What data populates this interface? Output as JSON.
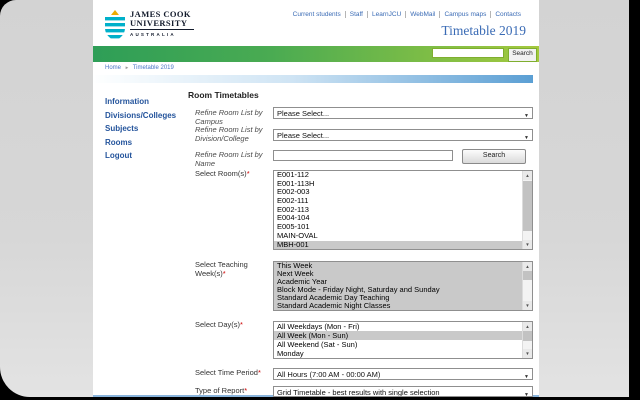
{
  "header": {
    "logo": {
      "line1": "JAMES COOK",
      "line2": "UNIVERSITY",
      "line3": "AUSTRALIA"
    },
    "top_links": [
      "Current students",
      "Staff",
      "LearnJCU",
      "WebMail",
      "Campus maps",
      "Contacts"
    ],
    "title": "Timetable 2019",
    "search": {
      "value": "",
      "button_label": "Search"
    }
  },
  "breadcrumb": {
    "home": "Home",
    "separator": "►",
    "current": "Timetable 2019"
  },
  "sidebar": {
    "items": [
      {
        "label": "Information"
      },
      {
        "label": "Divisions/Colleges"
      },
      {
        "label": "Subjects"
      },
      {
        "label": "Rooms"
      },
      {
        "label": "Logout"
      }
    ]
  },
  "form": {
    "heading": "Room Timetables",
    "campus": {
      "label": "Refine Room List by Campus",
      "value": "Please Select..."
    },
    "division": {
      "label": "Refine Room List by Division/College",
      "value": "Please Select..."
    },
    "name_filter": {
      "label": "Refine Room List by Name",
      "value": "",
      "button_label": "Search"
    },
    "rooms": {
      "label": "Select Room(s)",
      "required_mark": "*",
      "options": [
        {
          "label": "E001-112"
        },
        {
          "label": "E001-113H"
        },
        {
          "label": "E002-003"
        },
        {
          "label": "E002-111"
        },
        {
          "label": "E002-113"
        },
        {
          "label": "E004-104"
        },
        {
          "label": "E005-101"
        },
        {
          "label": "MAIN-OVAL"
        },
        {
          "label": "MBH-001",
          "selected": true
        }
      ]
    },
    "weeks": {
      "label": "Select Teaching Week(s)",
      "required_mark": "*",
      "options": [
        {
          "label": "This Week",
          "selected": true
        },
        {
          "label": "Next Week",
          "selected": true
        },
        {
          "label": "Academic Year",
          "selected": true
        },
        {
          "label": "Block Mode - Friday Night, Saturday and Sunday",
          "selected": true
        },
        {
          "label": "Standard Academic Day Teaching",
          "selected": true
        },
        {
          "label": "Standard Academic Night Classes",
          "selected": true
        }
      ]
    },
    "days": {
      "label": "Select Day(s)",
      "required_mark": "*",
      "options": [
        {
          "label": "All Weekdays (Mon - Fri)"
        },
        {
          "label": "All Week (Mon - Sun)",
          "selected": true
        },
        {
          "label": "All Weekend (Sat - Sun)"
        },
        {
          "label": "Monday"
        }
      ]
    },
    "time_period": {
      "label": "Select Time Period",
      "required_mark": "*",
      "value": "All Hours (7:00 AM - 00:00 AM)"
    },
    "report_type": {
      "label": "Type of Report",
      "required_mark": "*",
      "value": "Grid Timetable - best results with single selection"
    }
  },
  "icons": {
    "dropdown": "▼",
    "scroll_up": "▲",
    "scroll_down": "▼"
  },
  "colors": {
    "green_bar_start": "#2e9e57",
    "green_bar_end": "#a5c93e",
    "blue_bar": "#5b9fd4",
    "link_blue": "#24549c",
    "title_blue": "#3a6bb5",
    "required_red": "#cc0000",
    "selection_gray": "#c9c9c9",
    "shield_teal": "#00b0ca",
    "shield_gold": "#f0ab00"
  }
}
